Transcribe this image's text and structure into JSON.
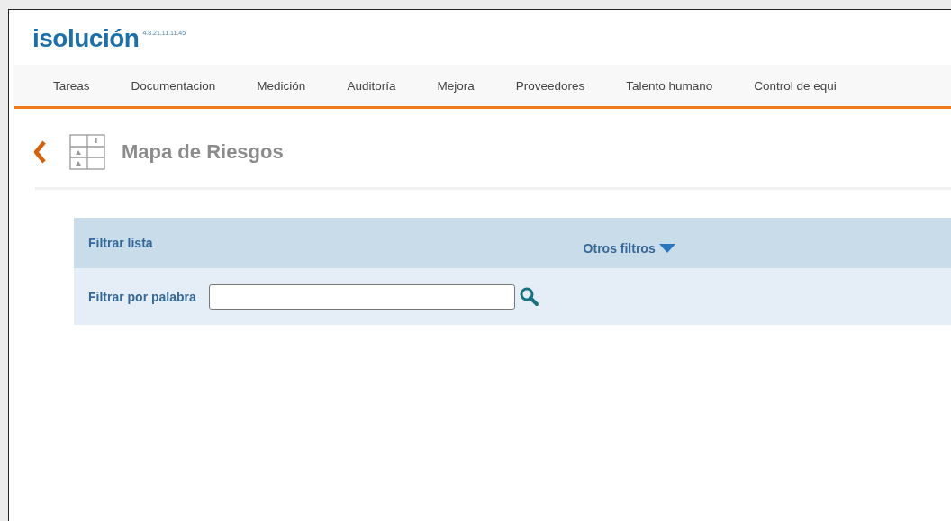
{
  "logo": {
    "name": "isolución",
    "version": "4.8.21.11.11.45"
  },
  "nav": {
    "items": [
      {
        "label": "Tareas"
      },
      {
        "label": "Documentacion"
      },
      {
        "label": "Medición"
      },
      {
        "label": "Auditoría"
      },
      {
        "label": "Mejora"
      },
      {
        "label": "Proveedores"
      },
      {
        "label": "Talento humano"
      },
      {
        "label": "Control de equi"
      }
    ]
  },
  "page": {
    "title": "Mapa de Riesgos"
  },
  "filter": {
    "title": "Filtrar lista",
    "other_filters": "Otros filtros",
    "word_label": "Filtrar por palabra"
  }
}
